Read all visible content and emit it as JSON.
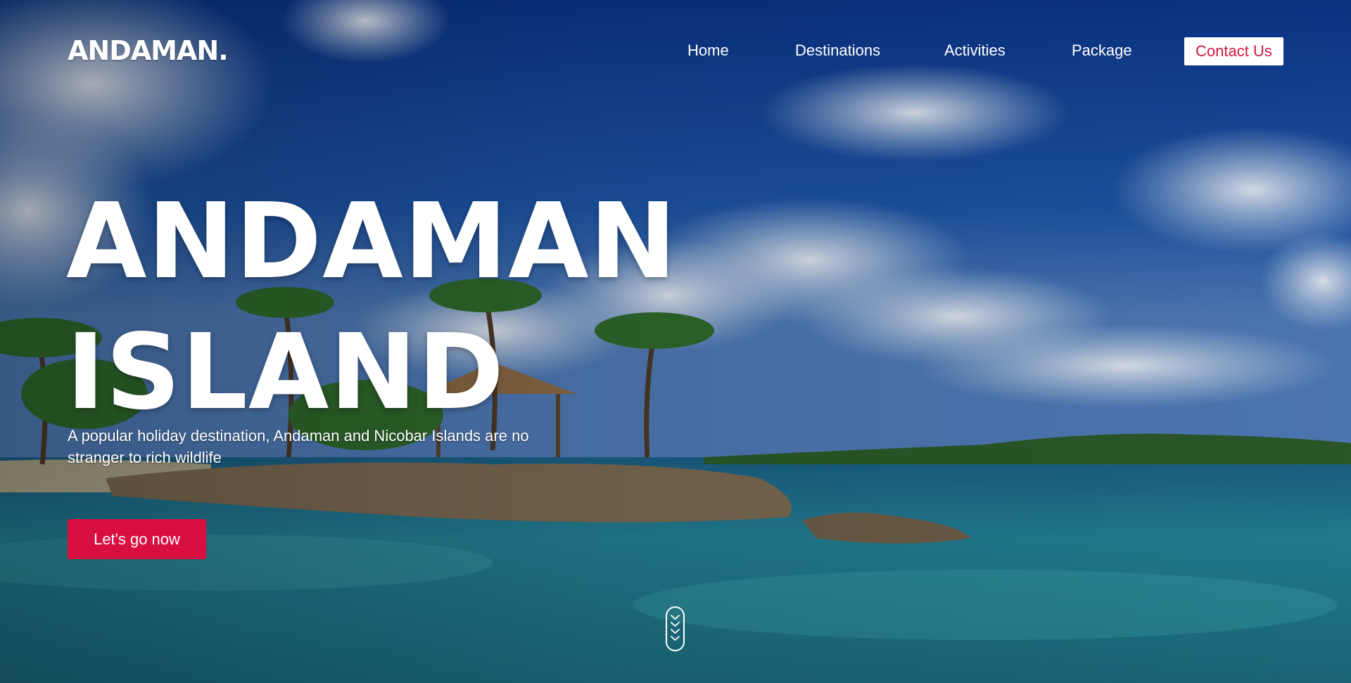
{
  "brand": {
    "logo_text": "ANDAMAN."
  },
  "nav": {
    "items": [
      {
        "label": "Home"
      },
      {
        "label": "Destinations"
      },
      {
        "label": "Activities"
      },
      {
        "label": "Package"
      }
    ],
    "contact_label": "Contact Us"
  },
  "hero": {
    "title_line1": "ANDAMAN",
    "title_line2": "ISLAND",
    "description": "A popular holiday destination, Andaman and Nicobar Islands are no stranger to rich wildlife",
    "cta_label": "Let's go now"
  },
  "scroll_indicator": {
    "icon": "chevrons-down-icon"
  },
  "colors": {
    "accent": "#d90f42",
    "contact_text": "#d01742",
    "sky_top": "#0a3a8f",
    "sea": "#1c6f86"
  }
}
